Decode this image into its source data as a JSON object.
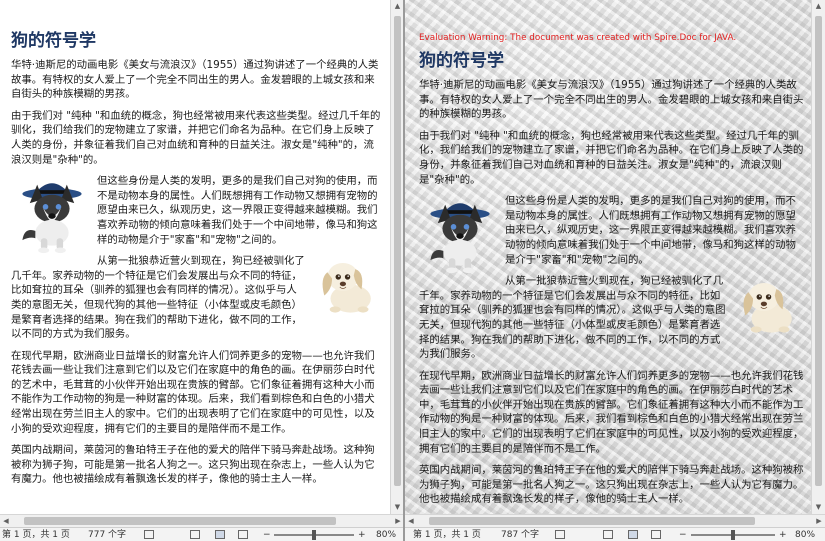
{
  "document": {
    "title": "狗的符号学",
    "paragraphs": [
      "华特·迪斯尼的动画电影《美女与流浪汉》（1955）通过狗讲述了一个经典的人类故事。有特权的女人爱上了一个完全不同出生的男人。金发碧眼的上城女孩和来自街头的种族模糊的男孩。",
      "由于我们对 \"纯种 \"和血统的概念，狗也经常被用来代表这些类型。经过几千年的驯化，我们给我们的宠物建立了家谱，并把它们命名为品种。在它们身上反映了人类的身份，并象征着我们自己对血统和育种的日益关注。淑女是\"纯种\"的，流浪汉则是\"杂种\"的。",
      "但这些身份是人类的发明，更多的是我们自己对狗的使用，而不是动物本身的属性。人们既想拥有工作动物又想拥有宠物的愿望由来已久，纵观历史，这一界限正变得越来越模糊。我们喜欢养动物的倾向意味着我们处于一个中间地带，像马和狗这样的动物是介于\"家畜\"和\"宠物\"之间的。",
      "从第一批狼恭近营火到现在，狗已经被驯化了几千年。家养动物的一个特征是它们会发展出与众不同的特征，比如耷拉的耳朵（驯养的狐狸也会有同样的情况）。这似乎与人类的意图无关，但现代狗的其他一些特征（小体型或皮毛颜色）是繁育者选择的结果。狗在我们的帮助下进化，做不同的工作，以不同的方式为我们服务。",
      "在现代早期，欧洲商业日益增长的财富允许人们饲养更多的宠物——也允许我们花钱去画一些让我们注意到它们以及它们在家庭中的角色的画。在伊丽莎白时代的艺术中，毛茸茸的小伙伴开始出现在贵族的臂部。它们象征着拥有这种大小而不能作为工作动物的狗是一种财富的体现。后来，我们看到棕色和白色的小猎犬经常出现在劳兰旧主人的家中。它们的出现表明了它们在家庭中的可见性，以及小狗的受欢迎程度，拥有它们的主要目的是陪伴而不是工作。",
      "英国内战期间，莱茵河的鲁珀特王子在他的爱犬的陪伴下骑马奔赴战场。这种狗被称为狮子狗，可能是第一批名人狗之一。这只狗出现在杂志上，一些人认为它有魔力。他也被描绘成有着飘逸长发的样子，像他的骑士主人一样。"
    ]
  },
  "right_pane": {
    "watermark_warning": "Evaluation Warning: The document was created with Spire.Doc for JAVA."
  },
  "left_status": {
    "page_info": "第 1 页，共 1 页",
    "word_count": "777 个字",
    "zoom": "80%"
  },
  "right_status": {
    "page_info": "第 1 页，共 1 页",
    "word_count": "787 个字",
    "zoom": "80%"
  },
  "icons": {
    "scroll_up": "▲",
    "scroll_down": "▼",
    "scroll_left": "◀",
    "scroll_right": "▶",
    "zoom_minus": "−",
    "zoom_plus": "+"
  }
}
